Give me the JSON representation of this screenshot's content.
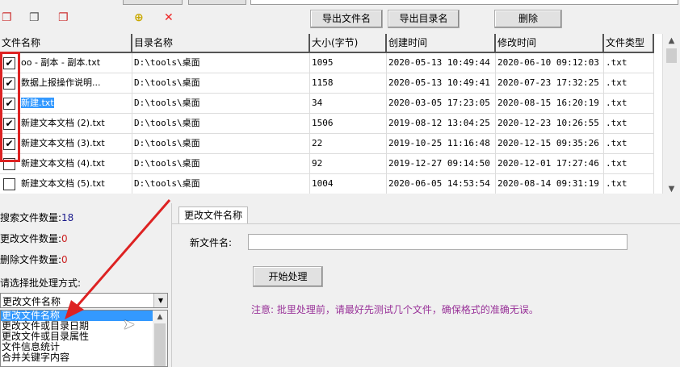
{
  "toolbar": {
    "icons": [
      "check-all-icon",
      "uncheck-all-icon",
      "invert-check-icon",
      "add-folder-icon",
      "remove-folder-icon"
    ],
    "export_files": "导出文件名",
    "export_dirs": "导出目录名",
    "delete": "删除"
  },
  "table": {
    "headers": [
      "文件名称",
      "目录名称",
      "大小(字节)",
      "创建时间",
      "修改时间",
      "文件类型"
    ],
    "rows": [
      {
        "checked": true,
        "name": "oo - 副本 - 副本.txt",
        "dir": "D:\\tools\\桌面",
        "size": "1095",
        "created": "2020-05-13 10:49:44",
        "modified": "2020-06-10 09:12:03",
        "type": ".txt"
      },
      {
        "checked": true,
        "name": "数据上报操作说明...",
        "dir": "D:\\tools\\桌面",
        "size": "1158",
        "created": "2020-05-13 10:49:41",
        "modified": "2020-07-23 17:32:25",
        "type": ".txt"
      },
      {
        "checked": true,
        "name": "新建.txt",
        "dir": "D:\\tools\\桌面",
        "size": "34",
        "created": "2020-03-05 17:23:05",
        "modified": "2020-08-15 16:20:19",
        "type": ".txt"
      },
      {
        "checked": true,
        "name": "新建文本文档 (2).txt",
        "dir": "D:\\tools\\桌面",
        "size": "1506",
        "created": "2019-08-12 13:04:25",
        "modified": "2020-12-23 10:26:55",
        "type": ".txt"
      },
      {
        "checked": true,
        "name": "新建文本文档 (3).txt",
        "dir": "D:\\tools\\桌面",
        "size": "22",
        "created": "2019-10-25 11:16:48",
        "modified": "2020-12-15 09:35:26",
        "type": ".txt"
      },
      {
        "checked": false,
        "name": "新建文本文档 (4).txt",
        "dir": "D:\\tools\\桌面",
        "size": "92",
        "created": "2019-12-27 09:14:50",
        "modified": "2020-12-01 17:27:46",
        "type": ".txt"
      },
      {
        "checked": false,
        "name": "新建文本文档 (5).txt",
        "dir": "D:\\tools\\桌面",
        "size": "1004",
        "created": "2020-06-05 14:53:54",
        "modified": "2020-08-14 09:31:19",
        "type": ".txt"
      }
    ]
  },
  "stats": {
    "search_label": "搜索文件数量:",
    "search_count": "18",
    "changed_label": "更改文件数量:",
    "changed_count": "0",
    "deleted_label": "删除文件数量:",
    "deleted_count": "0"
  },
  "mode": {
    "label": "请选择批处理方式:",
    "selected": "更改文件名称",
    "options": [
      "更改文件名称",
      "更改文件或目录日期",
      "更改文件或目录属性",
      "文件信息统计",
      "合并关键字内容"
    ]
  },
  "panel": {
    "tab": "更改文件名称",
    "new_name_label": "新文件名:",
    "new_name_value": "",
    "start": "开始处理",
    "note": "注意: 批里处理前，请最好先测试几个文件，确保格式的准确无误。"
  },
  "colors": {
    "highlight": "#3399ff",
    "annotation": "#dd2222",
    "note": "#993399",
    "count_blue": "#1a1a8c",
    "count_red": "#cc2222"
  }
}
